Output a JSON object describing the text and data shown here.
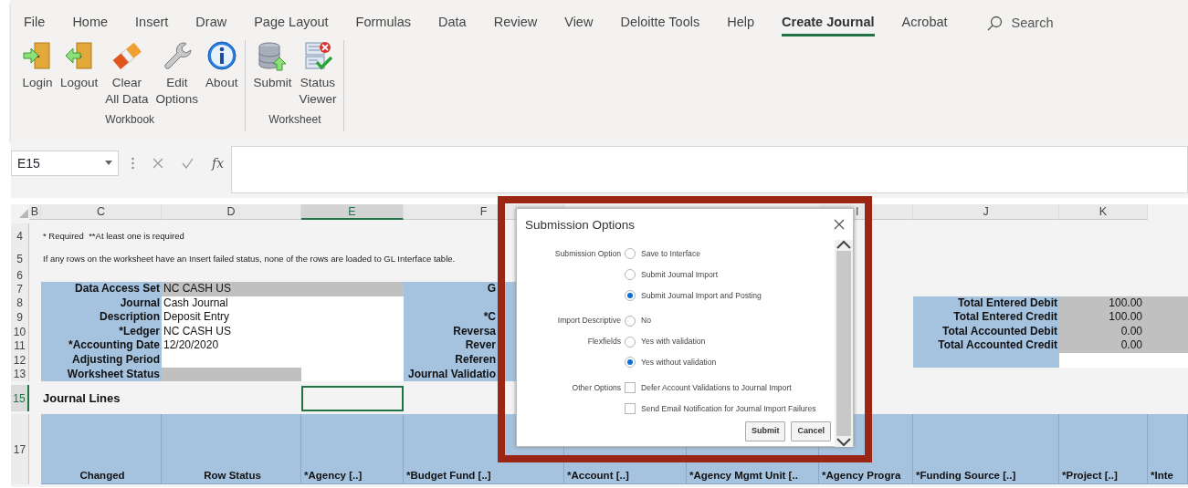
{
  "ribbon": {
    "tabs": [
      {
        "label": "File",
        "selected": false
      },
      {
        "label": "Home",
        "selected": false
      },
      {
        "label": "Insert",
        "selected": false
      },
      {
        "label": "Draw",
        "selected": false
      },
      {
        "label": "Page Layout",
        "selected": false
      },
      {
        "label": "Formulas",
        "selected": false
      },
      {
        "label": "Data",
        "selected": false
      },
      {
        "label": "Review",
        "selected": false
      },
      {
        "label": "View",
        "selected": false
      },
      {
        "label": "Deloitte Tools",
        "selected": false
      },
      {
        "label": "Help",
        "selected": false
      },
      {
        "label": "Create Journal",
        "selected": true
      },
      {
        "label": "Acrobat",
        "selected": false
      }
    ],
    "search": {
      "placeholder": "Search"
    },
    "groups": [
      {
        "label": "Workbook",
        "buttons": [
          {
            "lines": [
              "Login"
            ]
          },
          {
            "lines": [
              "Logout"
            ]
          },
          {
            "lines": [
              "Clear",
              "All Data"
            ]
          },
          {
            "lines": [
              "Edit",
              "Options"
            ]
          },
          {
            "lines": [
              "About"
            ]
          }
        ]
      },
      {
        "label": "Worksheet",
        "buttons": [
          {
            "lines": [
              "Submit"
            ]
          },
          {
            "lines": [
              "Status",
              "Viewer"
            ]
          }
        ]
      }
    ]
  },
  "formula_bar": {
    "name_box": "E15",
    "function_label": "fx"
  },
  "sheet": {
    "column_headers": [
      {
        "label": "B",
        "selected": false
      },
      {
        "label": "C",
        "selected": false
      },
      {
        "label": "D",
        "selected": false
      },
      {
        "label": "E",
        "selected": true
      },
      {
        "label": "F",
        "selected": false
      },
      {
        "label": "I",
        "selected": false
      },
      {
        "label": "J",
        "selected": false
      },
      {
        "label": "K",
        "selected": false
      }
    ],
    "row_headers": [
      {
        "label": "4",
        "selected": false
      },
      {
        "label": "5",
        "selected": false
      },
      {
        "label": "6",
        "selected": false
      },
      {
        "label": "7",
        "selected": false
      },
      {
        "label": "8",
        "selected": false
      },
      {
        "label": "9",
        "selected": false
      },
      {
        "label": "10",
        "selected": false
      },
      {
        "label": "11",
        "selected": false
      },
      {
        "label": "12",
        "selected": false
      },
      {
        "label": "13",
        "selected": false
      },
      {
        "label": "15",
        "selected": true
      },
      {
        "label": "17",
        "selected": false
      }
    ],
    "notes": [
      "* Required  **At least one is required",
      "If any rows on the worksheet have an Insert failed status, none of the rows are loaded to GL Interface table."
    ],
    "header_fields": [
      {
        "label": "Data Access Set",
        "value": "NC CASH US",
        "value_shaded": true,
        "next_shaded": true,
        "side_label": "G"
      },
      {
        "label": "Journal",
        "value": "Cash Journal"
      },
      {
        "label": "Description",
        "value": "Deposit Entry",
        "side_label": "*C"
      },
      {
        "label": "*Ledger",
        "value": "NC CASH US",
        "side_label": "Reversa"
      },
      {
        "label": "*Accounting Date",
        "value": "12/20/2020",
        "side_label": "Rever"
      },
      {
        "label": "Adjusting Period",
        "side_label": "Referen"
      },
      {
        "label": "Worksheet Status",
        "value_shaded": true,
        "side_label": "Journal Validatio"
      }
    ],
    "totals": [
      {
        "label": "Total Entered Debit",
        "value": "100.00"
      },
      {
        "label": "Total Entered Credit",
        "value": "100.00"
      },
      {
        "label": "Total Accounted Debit",
        "value": "0.00"
      },
      {
        "label": "Total Accounted Credit",
        "value": "0.00"
      }
    ],
    "section_title": "Journal Lines",
    "line_columns": [
      "Changed",
      "Row Status",
      "*Agency [..]",
      "*Budget Fund [..]",
      "*Account [..]",
      "*Agency Mgmt Unit [..",
      "*Agency Progra",
      "*Funding Source [..]",
      "*Project [..]",
      "*Inte"
    ]
  },
  "dialog": {
    "title": "Submission Options",
    "groups": [
      {
        "kind": "radio",
        "label_lines": [
          "Submission Option"
        ],
        "options": [
          {
            "label": "Save to Interface",
            "selected": false
          },
          {
            "label": "Submit Journal Import",
            "selected": false
          },
          {
            "label": "Submit Journal Import and Posting",
            "selected": true
          }
        ]
      },
      {
        "kind": "radio",
        "label_lines": [
          "Import Descriptive",
          "Flexfields"
        ],
        "options": [
          {
            "label": "No",
            "selected": false
          },
          {
            "label": "Yes with validation",
            "selected": false
          },
          {
            "label": "Yes without validation",
            "selected": true
          }
        ]
      },
      {
        "kind": "checkbox",
        "label_lines": [
          "Other Options"
        ],
        "options": [
          {
            "label": "Defer Account Validations to Journal Import",
            "checked": false
          },
          {
            "label": "Send Email Notification for Journal Import Failures",
            "checked": false
          }
        ]
      }
    ],
    "buttons": [
      "Submit",
      "Cancel"
    ]
  }
}
